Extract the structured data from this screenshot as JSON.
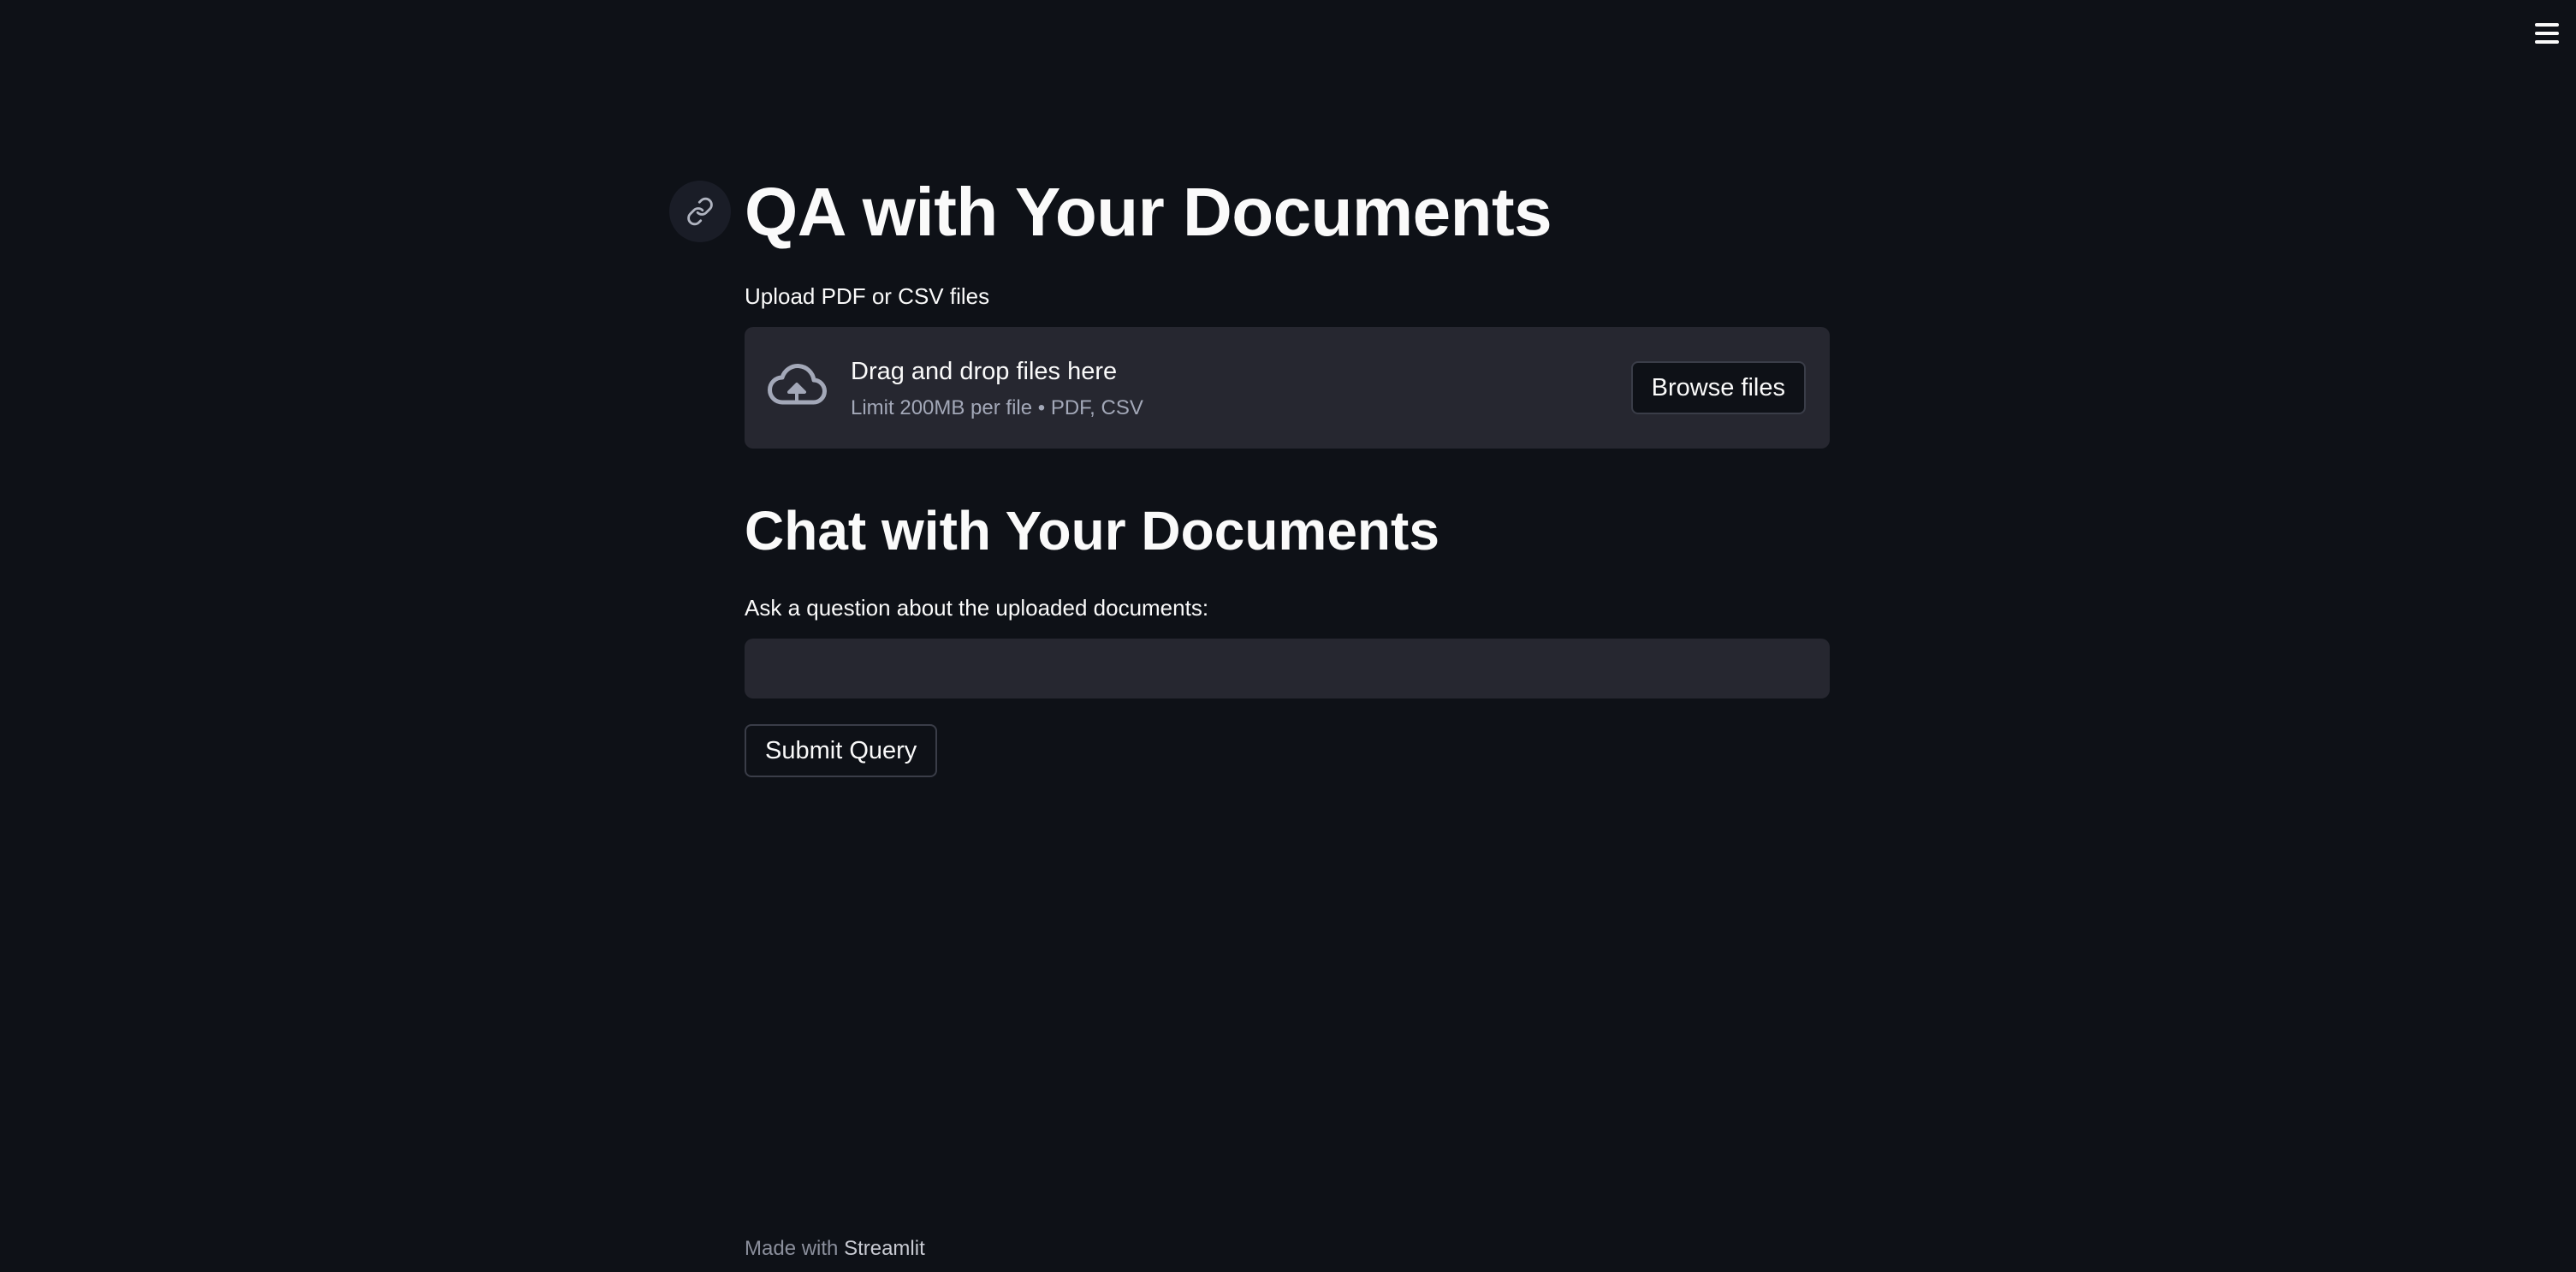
{
  "header": {
    "menu_icon": "hamburger-menu-icon"
  },
  "main": {
    "title": "QA with Your Documents",
    "anchor_icon": "link-icon",
    "uploader": {
      "label": "Upload PDF or CSV files",
      "icon": "cloud-upload-icon",
      "drop_text": "Drag and drop files here",
      "limit_text": "Limit 200MB per file • PDF, CSV",
      "browse_label": "Browse files"
    },
    "chat": {
      "title": "Chat with Your Documents",
      "question_label": "Ask a question about the uploaded documents:",
      "question_value": "",
      "submit_label": "Submit Query"
    }
  },
  "footer": {
    "made_with": "Made with",
    "brand": "Streamlit"
  },
  "colors": {
    "background": "#0e1117",
    "surface": "#262730",
    "text": "#fafafa",
    "muted_text": "#a3a8b8"
  }
}
